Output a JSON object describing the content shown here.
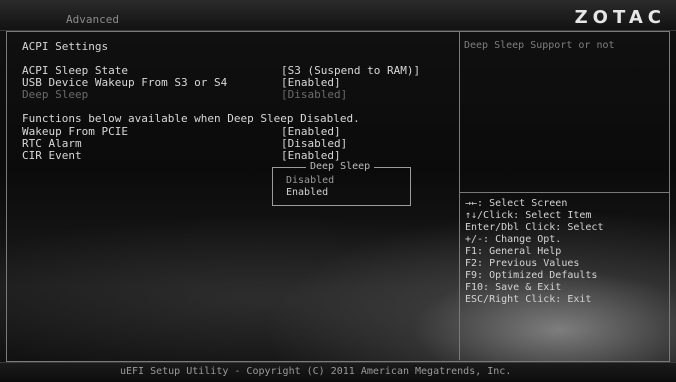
{
  "header": {
    "tab": "Advanced",
    "brand": "ZOTAC"
  },
  "main": {
    "section_title": "ACPI Settings",
    "settings": [
      {
        "label": "ACPI Sleep State",
        "value": "[S3 (Suspend to RAM)]",
        "state": "normal"
      },
      {
        "label": "USB Device Wakeup From S3 or S4",
        "value": "[Enabled]",
        "state": "normal"
      },
      {
        "label": "Deep Sleep",
        "value": "[Disabled]",
        "state": "disabled"
      }
    ],
    "note": "Functions below available when Deep Sleep Disabled.",
    "sub_settings": [
      {
        "label": "Wakeup From PCIE",
        "value": "[Enabled]"
      },
      {
        "label": "RTC Alarm",
        "value": "[Disabled]"
      },
      {
        "label": "CIR Event",
        "value": "[Enabled]"
      }
    ]
  },
  "popup": {
    "title": "Deep Sleep",
    "options": [
      "Disabled",
      "Enabled"
    ],
    "highlighted": "Enabled"
  },
  "help_text": "Deep Sleep Support or not",
  "key_legend": [
    "→←: Select Screen",
    "↑↓/Click: Select Item",
    "Enter/Dbl Click: Select",
    "+/-: Change Opt.",
    "F1: General Help",
    "F2: Previous Values",
    "F9: Optimized Defaults",
    "F10: Save & Exit",
    "ESC/Right Click: Exit"
  ],
  "footer": "uEFI Setup Utility - Copyright (C) 2011 American Megatrends, Inc."
}
